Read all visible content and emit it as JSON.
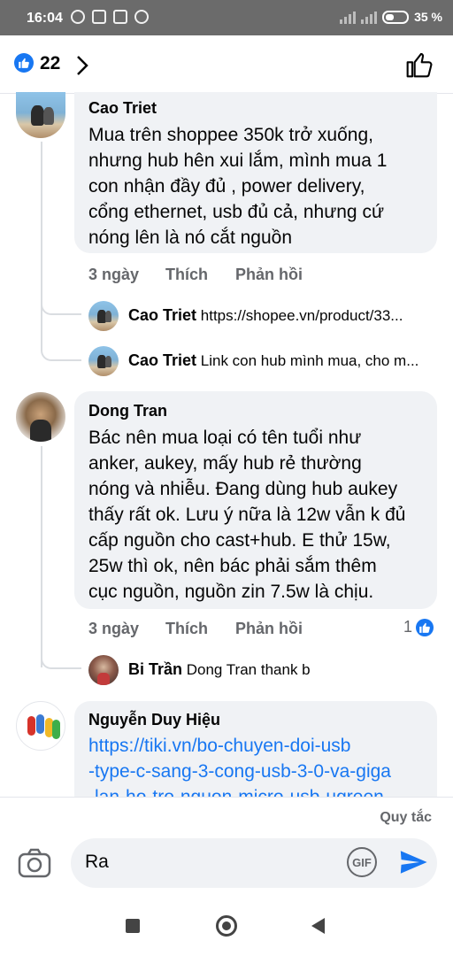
{
  "status_bar": {
    "time": "16:04",
    "battery": "35 %"
  },
  "header": {
    "like_count": "22"
  },
  "comments": [
    {
      "author": "Cao Triet",
      "text_lines": [
        "Mua trên shoppee 350k trở xuống,",
        "nhưng hub hên xui lắm, mình mua 1",
        "con nhận đầy đủ , power delivery,",
        "cổng ethernet, usb đủ cả, nhưng cứ",
        "nóng lên là nó cắt nguồn"
      ],
      "time": "3 ngày",
      "like_label": "Thích",
      "reply_label": "Phản hồi",
      "replies": [
        {
          "author": "Cao Triet",
          "text": "https://shopee.vn/product/33..."
        },
        {
          "author": "Cao Triet",
          "text": "Link con hub mình mua, cho m..."
        }
      ]
    },
    {
      "author": "Dong Tran",
      "text_lines": [
        "Bác nên mua loại có tên tuổi như",
        "anker, aukey, mấy hub rẻ thường",
        "nóng và nhiễu. Đang dùng hub aukey",
        "thấy rất ok. Lưu ý nữa là 12w vẫn k đủ",
        "cấp nguồn cho cast+hub. E thử 15w,",
        "25w thì ok, nên bác phải sắm thêm",
        "cục nguồn, nguồn zin 7.5w là chịu."
      ],
      "time": "3 ngày",
      "like_label": "Thích",
      "reply_label": "Phản hồi",
      "reaction_count": "1",
      "replies": [
        {
          "author": "Bi Trần",
          "text": "Dong Tran  thank b"
        }
      ]
    },
    {
      "author": "Nguyễn Duy Hiệu",
      "link_lines": [
        "https://tiki.vn/bo-chuyen-doi-usb",
        "-type-c-sang-3-cong-usb-3-0-va-giga",
        "-lan-ho-tro-nguon-micro-usb-ugreen"
      ]
    }
  ],
  "composer": {
    "rules_label": "Quy tắc",
    "input_value": "Ra",
    "gif_label": "GIF"
  }
}
